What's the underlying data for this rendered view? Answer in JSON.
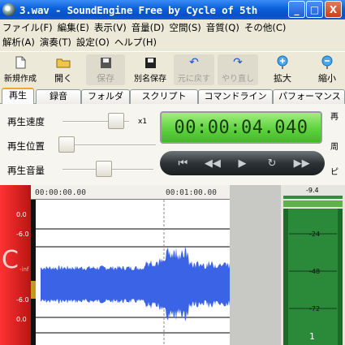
{
  "window": {
    "title": "3.wav - SoundEngine Free by Cycle of 5th",
    "min_label": "_",
    "max_label": "□",
    "close_label": "X"
  },
  "menu": {
    "row1": [
      "ファイル(F)",
      "編集(E)",
      "表示(V)",
      "音量(D)",
      "空間(S)",
      "音質(Q)",
      "その他(C)"
    ],
    "row2": [
      "解析(A)",
      "演奏(T)",
      "設定(O)",
      "ヘルプ(H)"
    ]
  },
  "toolbar": {
    "new": "新規作成",
    "open": "開く",
    "save": "保存",
    "save_as": "別名保存",
    "undo": "元に戻す",
    "redo": "やり直し",
    "zoom_in": "拡大",
    "zoom_out": "縮小"
  },
  "tabs": [
    "再生",
    "録音",
    "フォルダ",
    "スクリプト",
    "コマンドライン",
    "パフォーマンス"
  ],
  "controls": {
    "speed_label": "再生速度",
    "speed_multiplier": "x1",
    "position_label": "再生位置",
    "volume_label": "再生音量",
    "time_display": "00:00:04.040",
    "right_labels": [
      "再",
      "周",
      "ピ"
    ],
    "speed_level": 0.9,
    "position_level": 0.0,
    "volume_level": 0.45
  },
  "transport": {
    "start": "⏮",
    "rewind": "◀◀",
    "play": "▶",
    "loop": "↻",
    "forward": "▶▶"
  },
  "waveform": {
    "ruler_ticks": [
      "00:00:00.00",
      "00:01:00.00"
    ],
    "y_labels": [
      "0.0",
      "-6.0",
      "-inf",
      "-6.0",
      "0.0"
    ],
    "channel_letter": "C",
    "wave_color": "#3a63e6",
    "channel_color": "#e02a2a"
  },
  "meter": {
    "labels": [
      "-9.4",
      "-24",
      "-48",
      "-72"
    ],
    "channel": "1",
    "color": "#2f8f3f"
  }
}
